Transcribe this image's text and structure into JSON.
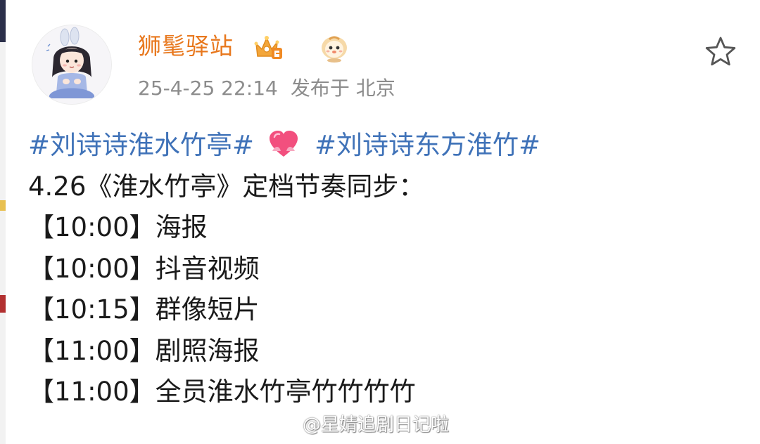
{
  "post": {
    "author": {
      "name": "狮髦驿站"
    },
    "meta": {
      "time": "25-4-25 22:14",
      "location": "发布于 北京"
    },
    "content": {
      "hashtag_1": "#刘诗诗淮水竹亭#",
      "hashtag_2": "#刘诗诗东方淮竹#",
      "lines": [
        "4.26《淮水竹亭》定档节奏同步：",
        "【10:00】海报",
        "【10:00】抖音视频",
        "【10:15】群像短片",
        "【11:00】剧照海报",
        "【11:00】全员淮水竹亭竹竹竹竹"
      ]
    }
  },
  "watermark": "@星婧追剧日记啦",
  "icons": {
    "favorite": "star-outline-icon",
    "vip": "crown-vip-icon",
    "mascot": "lion-mascot-icon",
    "emoji": "heart-emoji-icon"
  },
  "colors": {
    "username": "#e8781e",
    "hashtag": "#3f72b8",
    "meta": "#8c8c8c",
    "text": "#1a1a1a"
  }
}
